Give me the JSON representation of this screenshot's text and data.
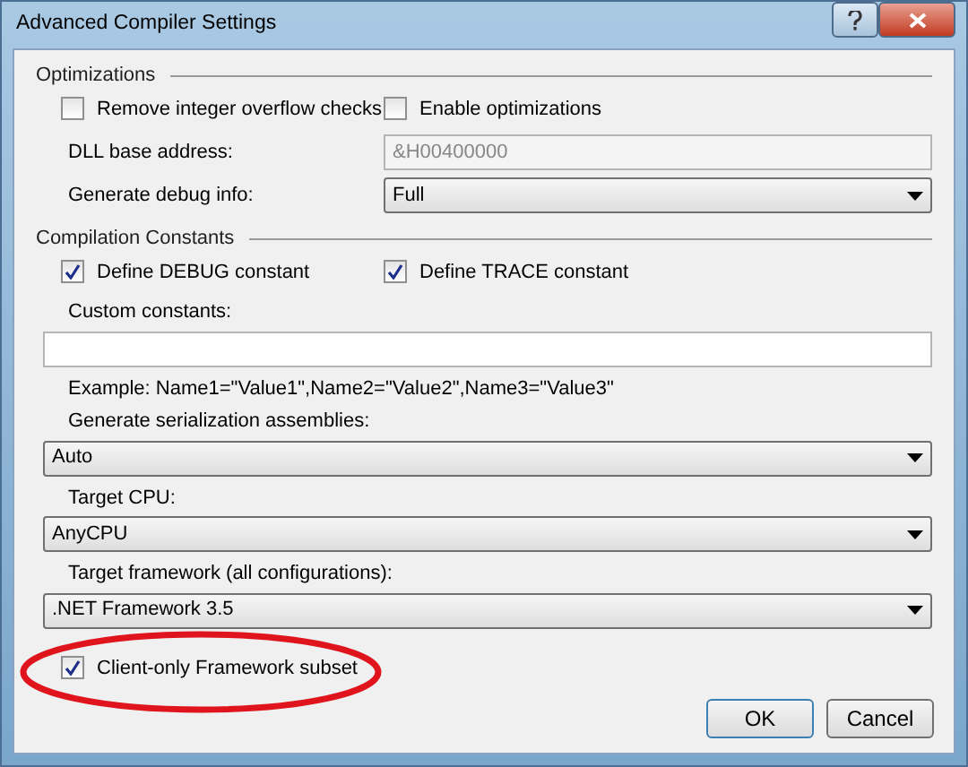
{
  "window": {
    "title": "Advanced Compiler Settings"
  },
  "sections": [
    {
      "title": "Optimizations",
      "rows": [
        {
          "kind": "checkboxes",
          "items": [
            {
              "label": "Remove integer overflow checks",
              "checked": false
            },
            {
              "label": "Enable optimizations",
              "checked": false
            }
          ]
        },
        {
          "kind": "inline_field",
          "label": "DLL base address:",
          "value": "&H00400000",
          "disabled": true
        },
        {
          "kind": "inline_select",
          "label": "Generate debug info:",
          "value": "Full"
        }
      ]
    },
    {
      "title": "Compilation Constants",
      "rows": [
        {
          "kind": "checkboxes",
          "items": [
            {
              "label": "Define DEBUG constant",
              "checked": true
            },
            {
              "label": "Define TRACE constant",
              "checked": true
            }
          ]
        },
        {
          "kind": "label",
          "text": "Custom constants:"
        },
        {
          "kind": "field",
          "value": ""
        },
        {
          "kind": "label",
          "text": "Example: Name1=\"Value1\",Name2=\"Value2\",Name3=\"Value3\""
        },
        {
          "kind": "label",
          "text": "Generate serialization assemblies:"
        },
        {
          "kind": "select",
          "value": "Auto"
        },
        {
          "kind": "label",
          "text": "Target CPU:"
        },
        {
          "kind": "select",
          "value": "AnyCPU"
        },
        {
          "kind": "label",
          "text": "Target framework (all configurations):"
        },
        {
          "kind": "select",
          "value": ".NET Framework 3.5"
        },
        {
          "kind": "checkbox",
          "label": "Client-only Framework subset",
          "checked": true,
          "circled": true
        }
      ]
    }
  ],
  "buttons": [
    {
      "label": "OK",
      "default": true
    },
    {
      "label": "Cancel",
      "default": false
    }
  ]
}
